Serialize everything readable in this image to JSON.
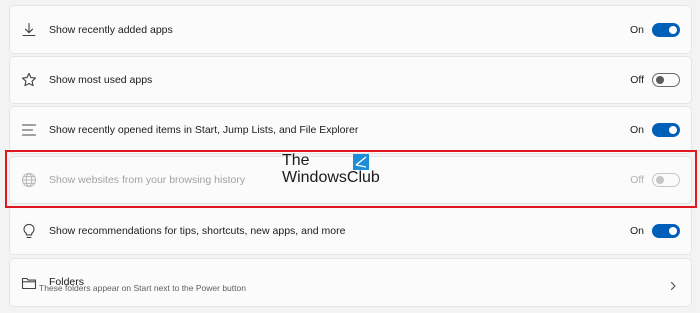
{
  "settings": [
    {
      "label": "Show recently added apps",
      "state": "On",
      "icon": "download-icon"
    },
    {
      "label": "Show most used apps",
      "state": "Off",
      "icon": "star-icon"
    },
    {
      "label": "Show recently opened items in Start, Jump Lists, and File Explorer",
      "state": "On",
      "icon": "list-lines-icon"
    },
    {
      "label": "Show websites from your browsing history",
      "state": "Off",
      "icon": "globe-icon",
      "disabled": true
    },
    {
      "label": "Show recommendations for tips, shortcuts, new apps, and more",
      "state": "On",
      "icon": "lightbulb-icon"
    }
  ],
  "folders": {
    "title": "Folders",
    "subtitle": "These folders appear on Start next to the Power button",
    "icon": "folder-icon"
  },
  "watermark": {
    "line1": "The",
    "line2": "WindowsClub"
  },
  "colors": {
    "accent": "#005fb8",
    "highlight": "#e0191c",
    "card": "#fbfbfb",
    "background": "#f3f3f3"
  }
}
